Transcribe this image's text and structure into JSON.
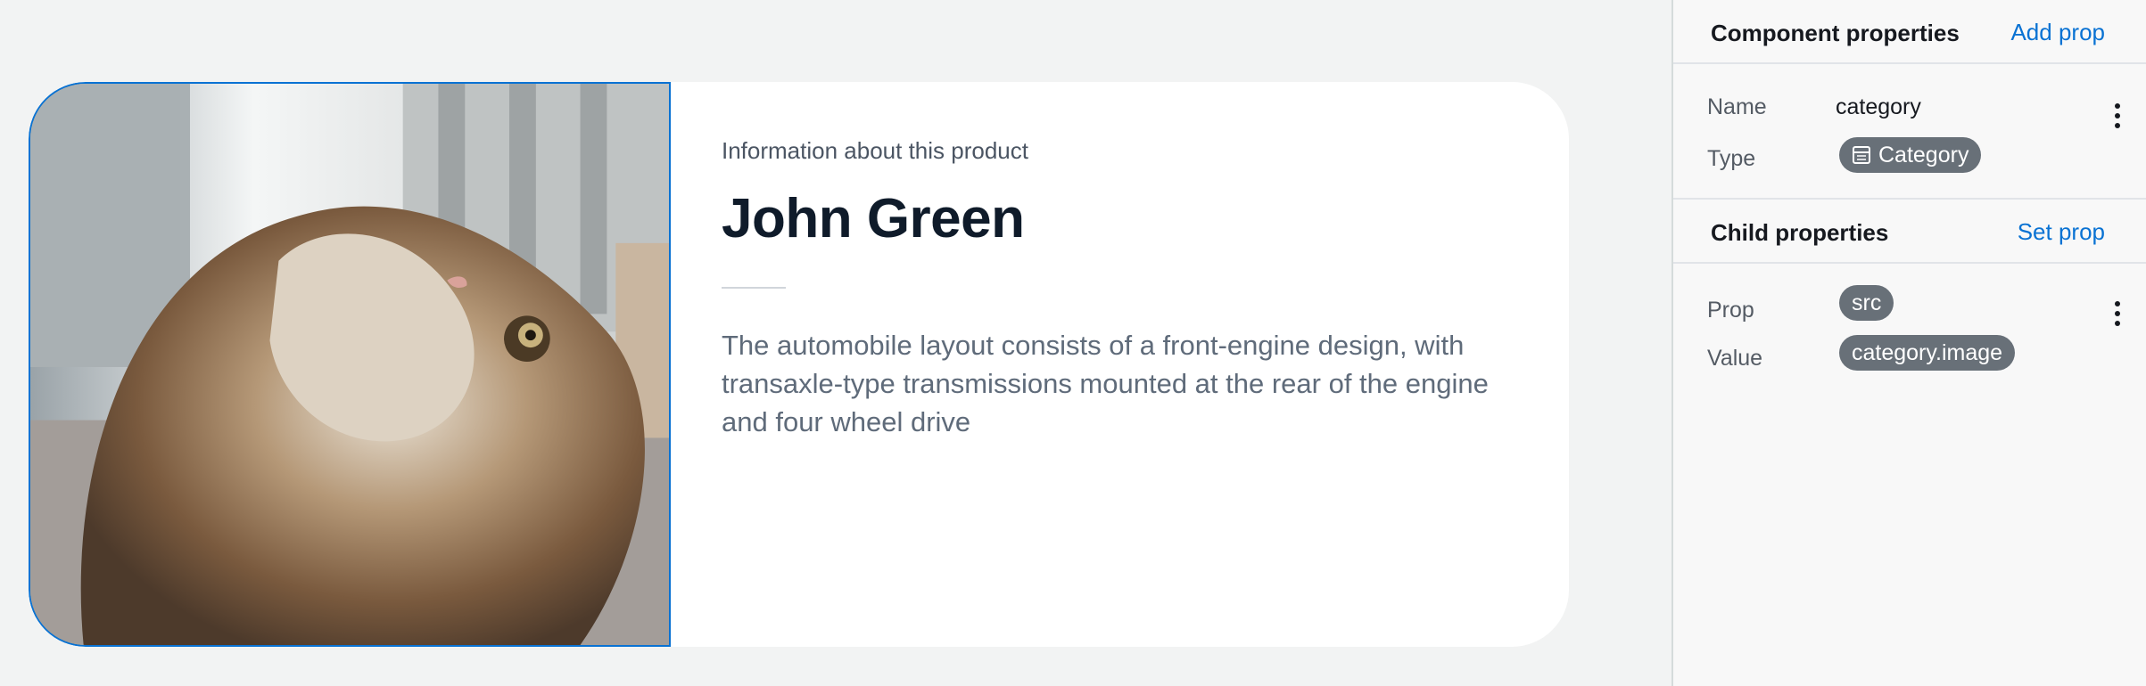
{
  "card": {
    "eyebrow": "Information about this product",
    "title": "John Green",
    "description": "The automobile layout consists of a front-engine design, with transaxle-type transmissions mounted at the rear of the engine and four wheel drive"
  },
  "panel": {
    "component": {
      "heading": "Component properties",
      "action": "Add prop",
      "name_label": "Name",
      "name_value": "category",
      "type_label": "Type",
      "type_value": "Category",
      "type_icon": "table-icon"
    },
    "child": {
      "heading": "Child properties",
      "action": "Set prop",
      "prop_label": "Prop",
      "prop_value": "src",
      "value_label": "Value",
      "value_value": "category.image"
    }
  },
  "colors": {
    "accent": "#0972d3",
    "badge": "#687078",
    "canvas": "#f2f3f3"
  }
}
